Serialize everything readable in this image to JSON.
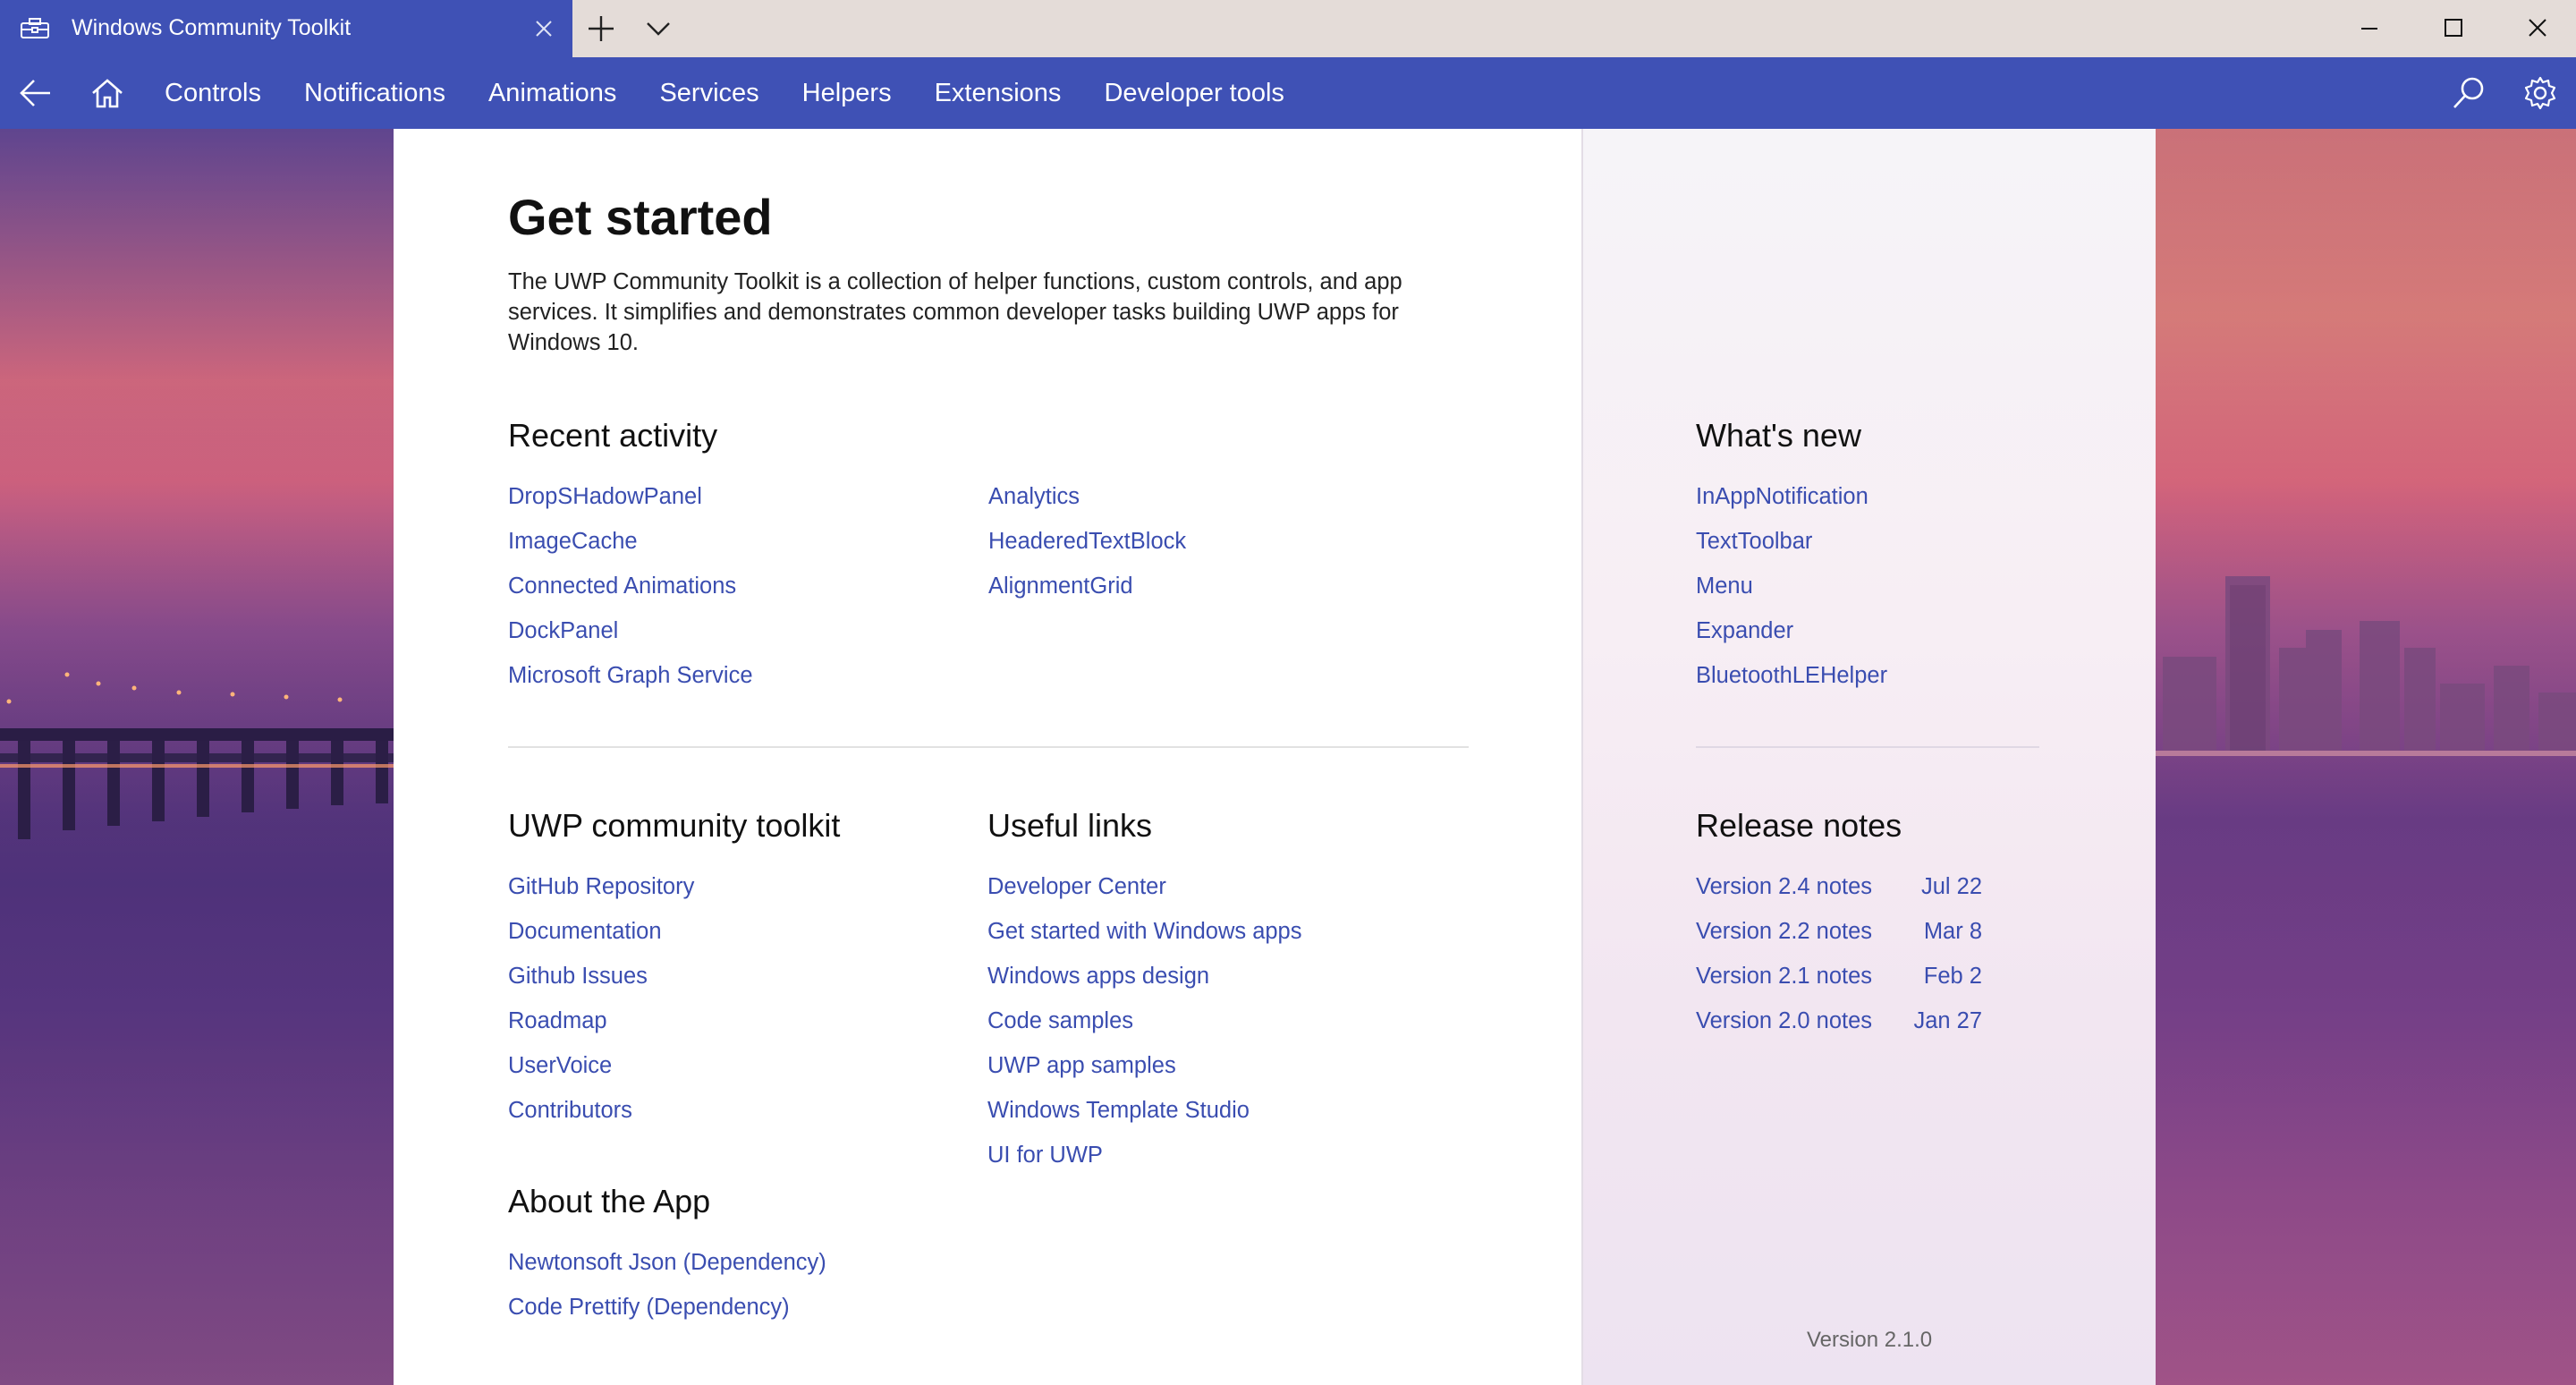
{
  "window": {
    "title": "Windows Community Toolkit"
  },
  "nav": {
    "items": [
      "Controls",
      "Notifications",
      "Animations",
      "Services",
      "Helpers",
      "Extensions",
      "Developer tools"
    ]
  },
  "intro": {
    "title": "Get started",
    "description": "The UWP Community Toolkit is a collection of helper functions, custom controls, and app services. It simplifies and demonstrates common developer tasks building UWP apps for Windows 10."
  },
  "recent": {
    "heading": "Recent activity",
    "col1": [
      "DropSHadowPanel",
      "ImageCache",
      "Connected Animations",
      "DockPanel",
      "Microsoft Graph Service"
    ],
    "col2": [
      "Analytics",
      "HeaderedTextBlock",
      "AlignmentGrid"
    ]
  },
  "toolkit": {
    "heading": "UWP community toolkit",
    "links": [
      "GitHub Repository",
      "Documentation",
      "Github Issues",
      "Roadmap",
      "UserVoice",
      "Contributors"
    ]
  },
  "useful": {
    "heading": "Useful links",
    "links": [
      "Developer Center",
      "Get started with Windows apps",
      "Windows apps design",
      "Code samples",
      "UWP app samples",
      "Windows Template Studio",
      "UI for UWP"
    ]
  },
  "about": {
    "heading": "About the App",
    "links": [
      "Newtonsoft Json (Dependency)",
      "Code Prettify (Dependency)"
    ]
  },
  "whats_new": {
    "heading": "What's new",
    "links": [
      "InAppNotification",
      "TextToolbar",
      "Menu",
      "Expander",
      "BluetoothLEHelper"
    ]
  },
  "release_notes": {
    "heading": "Release notes",
    "rows": [
      {
        "label": "Version 2.4 notes",
        "date": "Jul 22"
      },
      {
        "label": "Version 2.2 notes",
        "date": "Mar 8"
      },
      {
        "label": "Version 2.1 notes",
        "date": "Feb 2"
      },
      {
        "label": "Version 2.0 notes",
        "date": "Jan 27"
      }
    ]
  },
  "footer": {
    "version": "Version 2.1.0"
  },
  "colors": {
    "accent": "#3f51b5",
    "link": "#3a4db0",
    "titlebar": "#e4dcd8"
  },
  "icons": {
    "app": "toolbox-icon",
    "back": "back-arrow-icon",
    "home": "home-icon",
    "search": "search-icon",
    "settings": "gear-icon"
  }
}
